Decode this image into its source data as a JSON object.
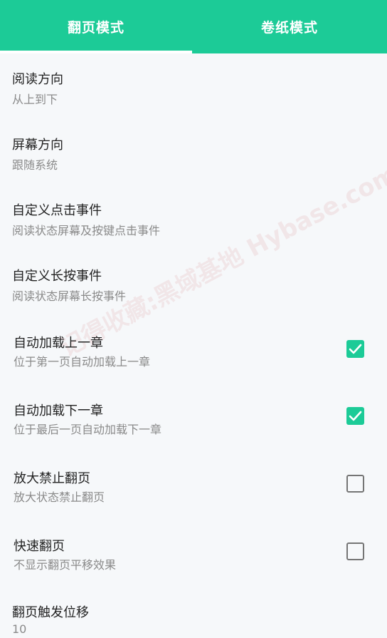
{
  "tabs": [
    {
      "label": "翻页模式"
    },
    {
      "label": "卷纸模式"
    }
  ],
  "settings": [
    {
      "title": "阅读方向",
      "subtitle": "从上到下"
    },
    {
      "title": "屏幕方向",
      "subtitle": "跟随系统"
    },
    {
      "title": "自定义点击事件",
      "subtitle": "阅读状态屏幕及按键点击事件"
    },
    {
      "title": "自定义长按事件",
      "subtitle": "阅读状态屏幕长按事件"
    },
    {
      "title": "自动加载上一章",
      "subtitle": "位于第一页自动加载上一章",
      "checked": true
    },
    {
      "title": "自动加载下一章",
      "subtitle": "位于最后一页自动加载下一章",
      "checked": true
    },
    {
      "title": "放大禁止翻页",
      "subtitle": "放大状态禁止翻页",
      "checked": false
    },
    {
      "title": "快速翻页",
      "subtitle": "不显示翻页平移效果",
      "checked": false
    },
    {
      "title": "翻页触发位移",
      "subtitle": "10"
    }
  ],
  "watermark": "记得收藏:黑域基地 Hybase.com",
  "colors": {
    "accent": "#1ccb97",
    "unchecked": "#757575"
  }
}
